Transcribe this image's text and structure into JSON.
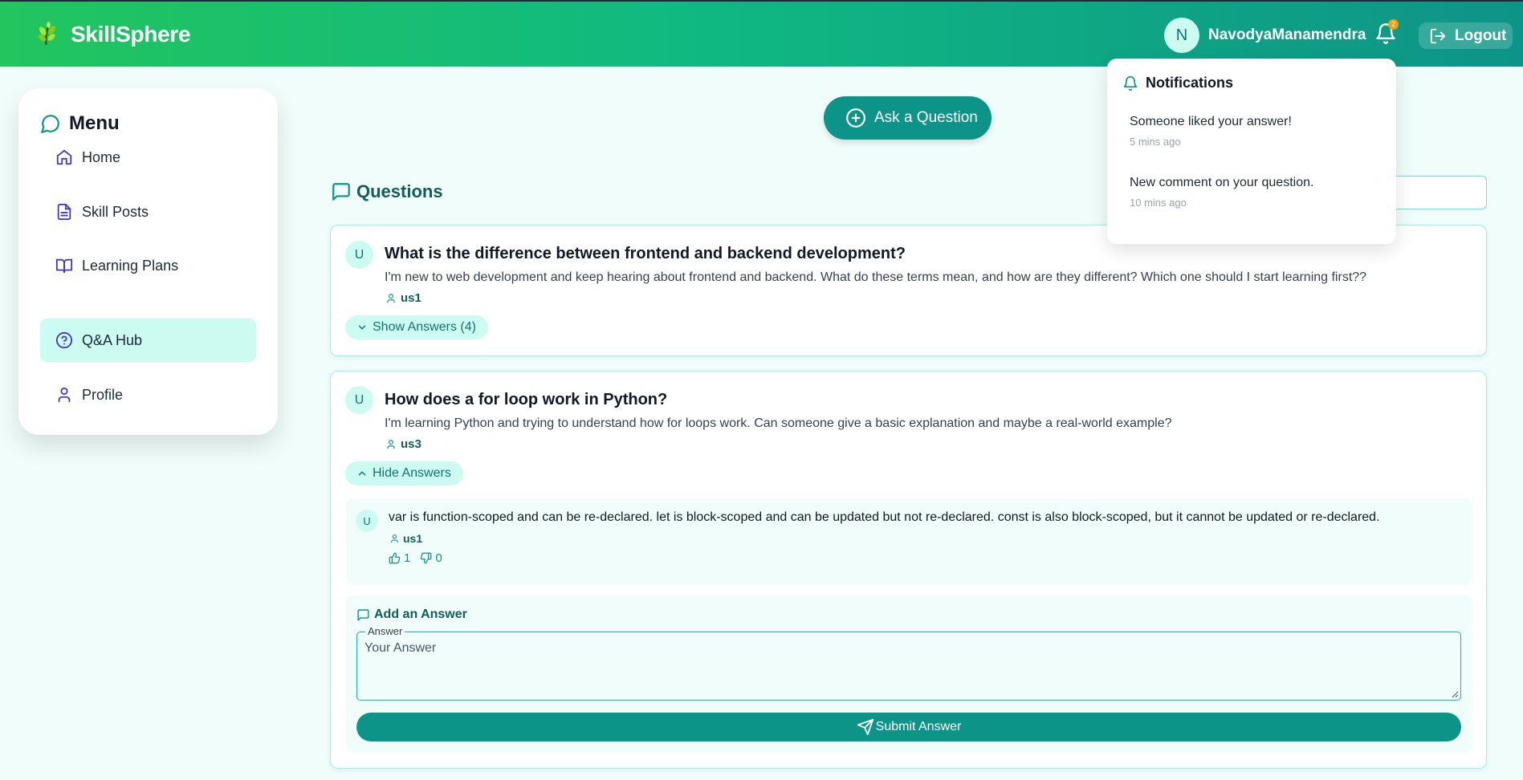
{
  "header": {
    "brand": "SkillSphere",
    "user_initial": "N",
    "username": "NavodyaManamendra",
    "notification_count": "2",
    "logout_label": "Logout"
  },
  "sidebar": {
    "title": "Menu",
    "items": [
      {
        "label": "Home",
        "icon": "home-icon"
      },
      {
        "label": "Skill Posts",
        "icon": "document-icon"
      },
      {
        "label": "Learning Plans",
        "icon": "book-icon"
      },
      {
        "label": "Q&A Hub",
        "icon": "question-icon",
        "active": true
      },
      {
        "label": "Profile",
        "icon": "user-icon"
      }
    ]
  },
  "main": {
    "ask_button": "Ask a Question",
    "heading": "Questions",
    "questions": [
      {
        "avatar": "U",
        "title": "What is the difference between frontend and backend development?",
        "body": "I'm new to web development and keep hearing about frontend and backend. What do these terms mean, and how are they different? Which one should I start learning first??",
        "author": "us1",
        "toggle": "Show Answers (4)"
      },
      {
        "avatar": "U",
        "title": "How does a for loop work in Python?",
        "body": "I'm learning Python and trying to understand how for loops work. Can someone give a basic explanation and maybe a real-world example?",
        "author": "us3",
        "toggle": "Hide Answers",
        "answers": [
          {
            "avatar": "U",
            "text": "var is function-scoped and can be re-declared. let is block-scoped and can be updated but not re-declared. const is also block-scoped, but it cannot be updated or re-declared.",
            "author": "us1",
            "likes": "1",
            "dislikes": "0"
          }
        ],
        "add_answer": {
          "title": "Add an Answer",
          "field_label": "Answer",
          "placeholder": "Your Answer",
          "submit": "Submit Answer"
        }
      }
    ]
  },
  "notifications": {
    "title": "Notifications",
    "items": [
      {
        "message": "Someone liked your answer!",
        "time": "5 mins ago"
      },
      {
        "message": "New comment on your question.",
        "time": "10 mins ago"
      }
    ]
  },
  "colors": {
    "brand_green": "#22c55e",
    "brand_teal": "#0d9488",
    "accent_light": "#ccfbf1",
    "background": "#f0fdfa"
  }
}
